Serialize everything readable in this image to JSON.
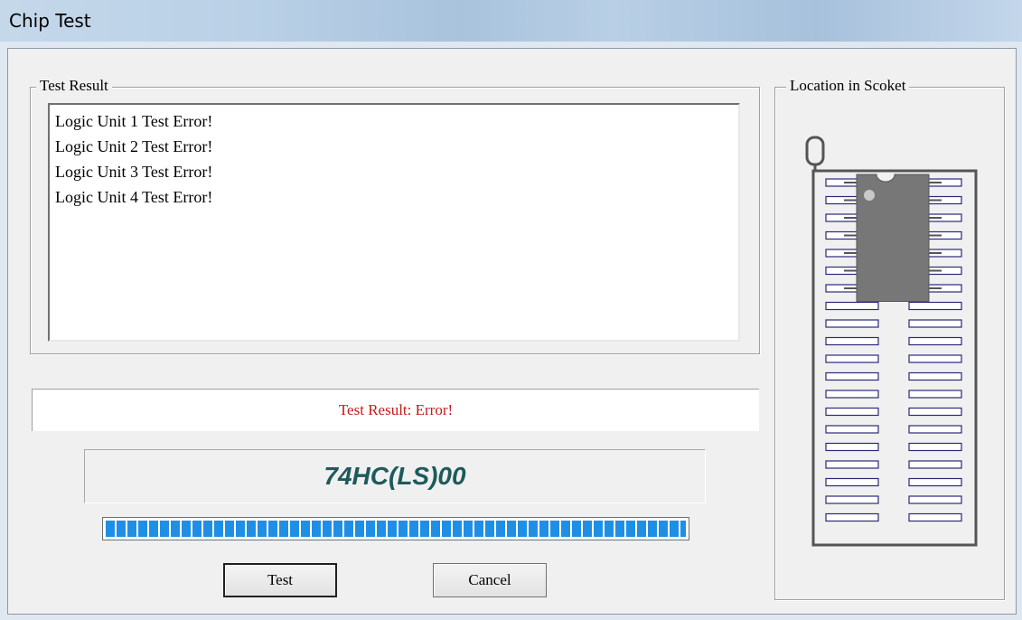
{
  "window": {
    "title": "Chip Test"
  },
  "test_result_group": {
    "label": "Test Result",
    "items": [
      "Logic Unit 1 Test Error!",
      "Logic Unit 2 Test Error!",
      "Logic Unit 3 Test Error!",
      "Logic Unit 4 Test Error!"
    ]
  },
  "status": {
    "text": "Test Result:  Error!",
    "color": "#c41a1a"
  },
  "chip": {
    "name": "74HC(LS)00",
    "color": "#1e5a5a"
  },
  "progress": {
    "fraction": 1.0,
    "color": "#1f8fe6"
  },
  "buttons": {
    "test_label": "Test",
    "cancel_label": "Cancel"
  },
  "socket_group": {
    "label": "Location in Scoket",
    "slot_count_per_side": 20,
    "chip_pin_count_per_side": 7
  }
}
